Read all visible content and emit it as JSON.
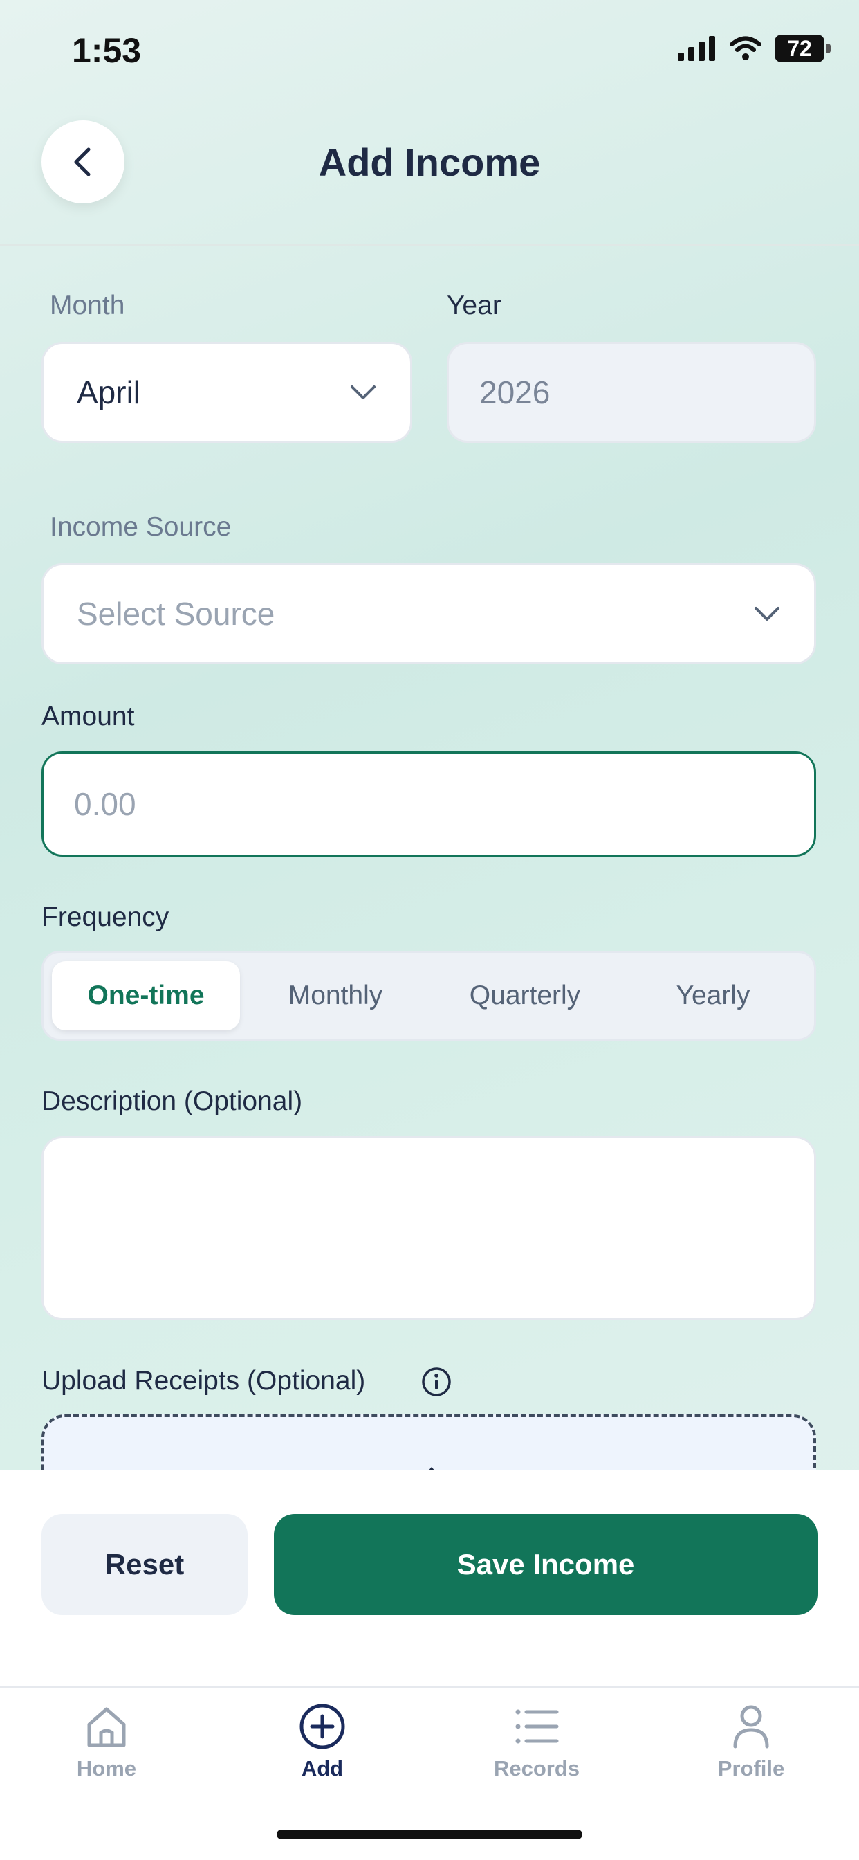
{
  "status": {
    "time": "1:53",
    "battery": "72"
  },
  "header": {
    "title": "Add Income"
  },
  "form": {
    "month_label": "Month",
    "month_value": "April",
    "year_label": "Year",
    "year_value": "2026",
    "source_label": "Income Source",
    "source_placeholder": "Select Source",
    "amount_label": "Amount",
    "amount_placeholder": "0.00",
    "frequency_label": "Frequency",
    "frequency_options": [
      "One-time",
      "Monthly",
      "Quarterly",
      "Yearly"
    ],
    "frequency_selected": "One-time",
    "description_label": "Description (Optional)",
    "description_value": "",
    "upload_label": "Upload Receipts (Optional)"
  },
  "actions": {
    "reset_label": "Reset",
    "save_label": "Save Income"
  },
  "tabbar": {
    "items": [
      {
        "label": "Home",
        "icon": "home-icon"
      },
      {
        "label": "Add",
        "icon": "add-circle-icon"
      },
      {
        "label": "Records",
        "icon": "list-icon"
      },
      {
        "label": "Profile",
        "icon": "user-icon"
      }
    ],
    "active": "Add"
  },
  "colors": {
    "accent": "#127559",
    "active_tab": "#1a2a5c"
  }
}
